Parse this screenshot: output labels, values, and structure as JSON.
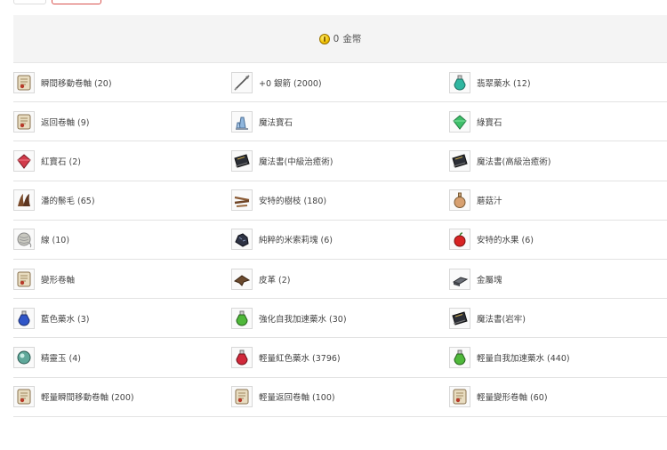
{
  "coins": {
    "amount": "0",
    "unit": "金幣"
  },
  "rows": [
    [
      {
        "label": "瞬間移動卷軸 (20)",
        "icon": "scroll-icon"
      },
      {
        "label": "+0 銀箭 (2000)",
        "icon": "arrow-icon"
      },
      {
        "label": "翡翠藥水 (12)",
        "icon": "teal-potion-icon"
      }
    ],
    [
      {
        "label": "返回卷軸 (9)",
        "icon": "scroll-icon"
      },
      {
        "label": "魔法寶石",
        "icon": "crystal-icon"
      },
      {
        "label": "綠寶石",
        "icon": "emerald-icon"
      }
    ],
    [
      {
        "label": "紅寶石 (2)",
        "icon": "ruby-icon"
      },
      {
        "label": "魔法書(中級治癒術)",
        "icon": "spellbook-icon"
      },
      {
        "label": "魔法書(高級治癒術)",
        "icon": "spellbook-icon"
      }
    ],
    [
      {
        "label": "潘的鬃毛 (65)",
        "icon": "mane-icon"
      },
      {
        "label": "安特的樹枝 (180)",
        "icon": "branch-icon"
      },
      {
        "label": "蘑菇汁",
        "icon": "flask-icon"
      }
    ],
    [
      {
        "label": "線 (10)",
        "icon": "thread-icon"
      },
      {
        "label": "純粹的米索莉塊 (6)",
        "icon": "ore-icon"
      },
      {
        "label": "安特的水果 (6)",
        "icon": "apple-icon"
      }
    ],
    [
      {
        "label": "變形卷軸",
        "icon": "scroll-icon"
      },
      {
        "label": "皮革 (2)",
        "icon": "leather-icon"
      },
      {
        "label": "金屬塊",
        "icon": "metal-icon"
      }
    ],
    [
      {
        "label": "藍色藥水 (3)",
        "icon": "blue-potion-icon"
      },
      {
        "label": "強化自我加速藥水 (30)",
        "icon": "green-potion-icon"
      },
      {
        "label": "魔法書(岩牢)",
        "icon": "spellbook-icon"
      }
    ],
    [
      {
        "label": "精靈玉 (4)",
        "icon": "orb-icon"
      },
      {
        "label": "輕量紅色藥水 (3796)",
        "icon": "red-potion-icon"
      },
      {
        "label": "輕量自我加速藥水 (440)",
        "icon": "green-potion-icon"
      }
    ],
    [
      {
        "label": "輕量瞬間移動卷軸 (200)",
        "icon": "scroll-icon"
      },
      {
        "label": "輕量返回卷軸 (100)",
        "icon": "scroll-icon"
      },
      {
        "label": "輕量變形卷軸 (60)",
        "icon": "scroll-icon"
      }
    ]
  ]
}
